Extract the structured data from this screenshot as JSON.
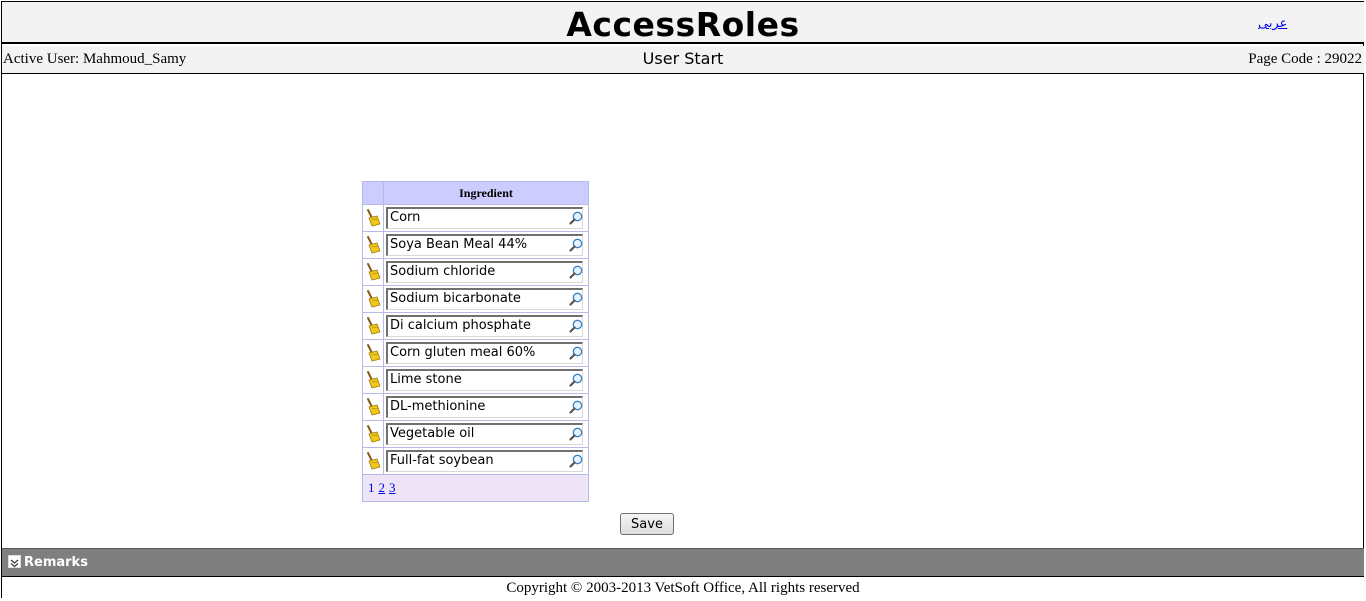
{
  "header": {
    "title": "AccessRoles",
    "language_link": "عربى"
  },
  "info": {
    "active_user": "Active User: Mahmoud_Samy",
    "page_name": "User Start",
    "page_code": "Page Code : 29022"
  },
  "grid": {
    "column_header": "Ingredient",
    "rows": [
      {
        "value": "Corn"
      },
      {
        "value": "Soya Bean Meal 44%"
      },
      {
        "value": "Sodium chloride"
      },
      {
        "value": "Sodium bicarbonate"
      },
      {
        "value": "Di calcium phosphate"
      },
      {
        "value": "Corn gluten meal 60%"
      },
      {
        "value": "Lime stone"
      },
      {
        "value": "DL-methionine"
      },
      {
        "value": "Vegetable oil"
      },
      {
        "value": "Full-fat soybean"
      }
    ],
    "pager": {
      "current": "1",
      "pages": [
        "2",
        "3"
      ]
    }
  },
  "actions": {
    "save_label": "Save"
  },
  "remarks": {
    "label": "Remarks"
  },
  "footer": {
    "copyright": "Copyright © 2003-2013 VetSoft Office, All rights reserved"
  },
  "icons": {
    "clear": "broom-icon",
    "search": "magnifier-icon",
    "collapse": "collapse-icon"
  },
  "colors": {
    "grid_header": "#ccccff",
    "grid_border": "#b9b9e8",
    "pager_bg": "#ede4f7",
    "remarks_bar": "#7f7f7f",
    "title_bar": "#f3f3f3"
  }
}
